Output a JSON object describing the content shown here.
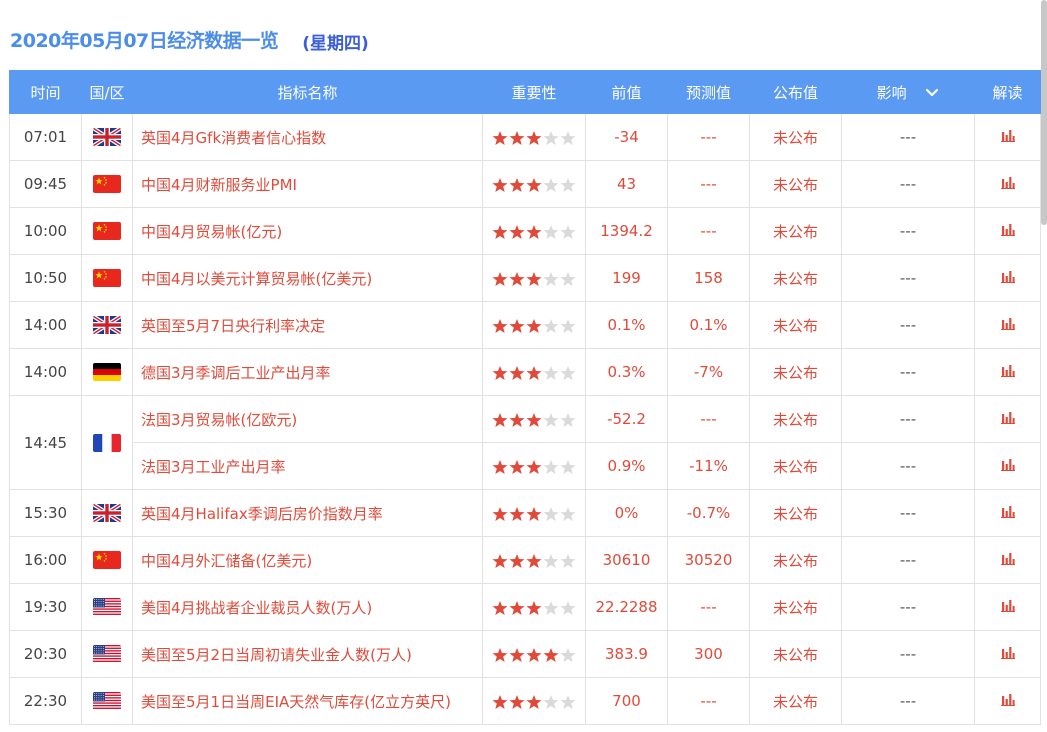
{
  "header": {
    "title": "2020年05月07日经济数据一览",
    "weekday": "(星期四)"
  },
  "table": {
    "columns": {
      "time": "时间",
      "country": "国/区",
      "indicator": "指标名称",
      "importance": "重要性",
      "previous": "前值",
      "forecast": "预测值",
      "actual": "公布值",
      "impact": "影响",
      "analysis": "解读"
    },
    "rows": [
      {
        "time": "07:01",
        "flag": "uk-flag",
        "name": "英国4月Gfk消费者信心指数",
        "stars": 3,
        "previous": "-34",
        "forecast": "---",
        "actual": "未公布",
        "impact": "---"
      },
      {
        "time": "09:45",
        "flag": "china-flag",
        "name": "中国4月财新服务业PMI",
        "stars": 3,
        "previous": "43",
        "forecast": "---",
        "actual": "未公布",
        "impact": "---"
      },
      {
        "time": "10:00",
        "flag": "china-flag",
        "name": "中国4月贸易帐(亿元)",
        "stars": 3,
        "previous": "1394.2",
        "forecast": "---",
        "actual": "未公布",
        "impact": "---"
      },
      {
        "time": "10:50",
        "flag": "china-flag",
        "name": "中国4月以美元计算贸易帐(亿美元)",
        "stars": 3,
        "previous": "199",
        "forecast": "158",
        "actual": "未公布",
        "impact": "---"
      },
      {
        "time": "14:00",
        "flag": "uk-flag",
        "name": "英国至5月7日央行利率决定",
        "stars": 3,
        "previous": "0.1%",
        "forecast": "0.1%",
        "actual": "未公布",
        "impact": "---"
      },
      {
        "time": "14:00",
        "flag": "germany-flag",
        "name": "德国3月季调后工业产出月率",
        "stars": 3,
        "previous": "0.3%",
        "forecast": "-7%",
        "actual": "未公布",
        "impact": "---"
      },
      {
        "time": "14:45",
        "flag": "france-flag",
        "span": 2,
        "name": "法国3月贸易帐(亿欧元)",
        "stars": 3,
        "previous": "-52.2",
        "forecast": "---",
        "actual": "未公布",
        "impact": "---"
      },
      {
        "cont": true,
        "name": "法国3月工业产出月率",
        "stars": 3,
        "previous": "0.9%",
        "forecast": "-11%",
        "actual": "未公布",
        "impact": "---"
      },
      {
        "time": "15:30",
        "flag": "uk-flag",
        "name": "英国4月Halifax季调后房价指数月率",
        "stars": 3,
        "previous": "0%",
        "forecast": "-0.7%",
        "actual": "未公布",
        "impact": "---"
      },
      {
        "time": "16:00",
        "flag": "china-flag",
        "name": "中国4月外汇储备(亿美元)",
        "stars": 3,
        "previous": "30610",
        "forecast": "30520",
        "actual": "未公布",
        "impact": "---"
      },
      {
        "time": "19:30",
        "flag": "usa-flag",
        "name": "美国4月挑战者企业裁员人数(万人)",
        "stars": 3,
        "previous": "22.2288",
        "forecast": "---",
        "actual": "未公布",
        "impact": "---"
      },
      {
        "time": "20:30",
        "flag": "usa-flag",
        "name": "美国至5月2日当周初请失业金人数(万人)",
        "stars": 4,
        "previous": "383.9",
        "forecast": "300",
        "actual": "未公布",
        "impact": "---"
      },
      {
        "time": "22:30",
        "flag": "usa-flag",
        "name": "美国至5月1日当周EIA天然气库存(亿立方英尺)",
        "stars": 3,
        "previous": "700",
        "forecast": "---",
        "actual": "未公布",
        "impact": "---"
      }
    ]
  },
  "colors": {
    "header_bg": "#5b9af3",
    "accent_red": "#e04a3a",
    "title_blue": "#4b8de8",
    "weekday_blue": "#3b5fd9"
  }
}
